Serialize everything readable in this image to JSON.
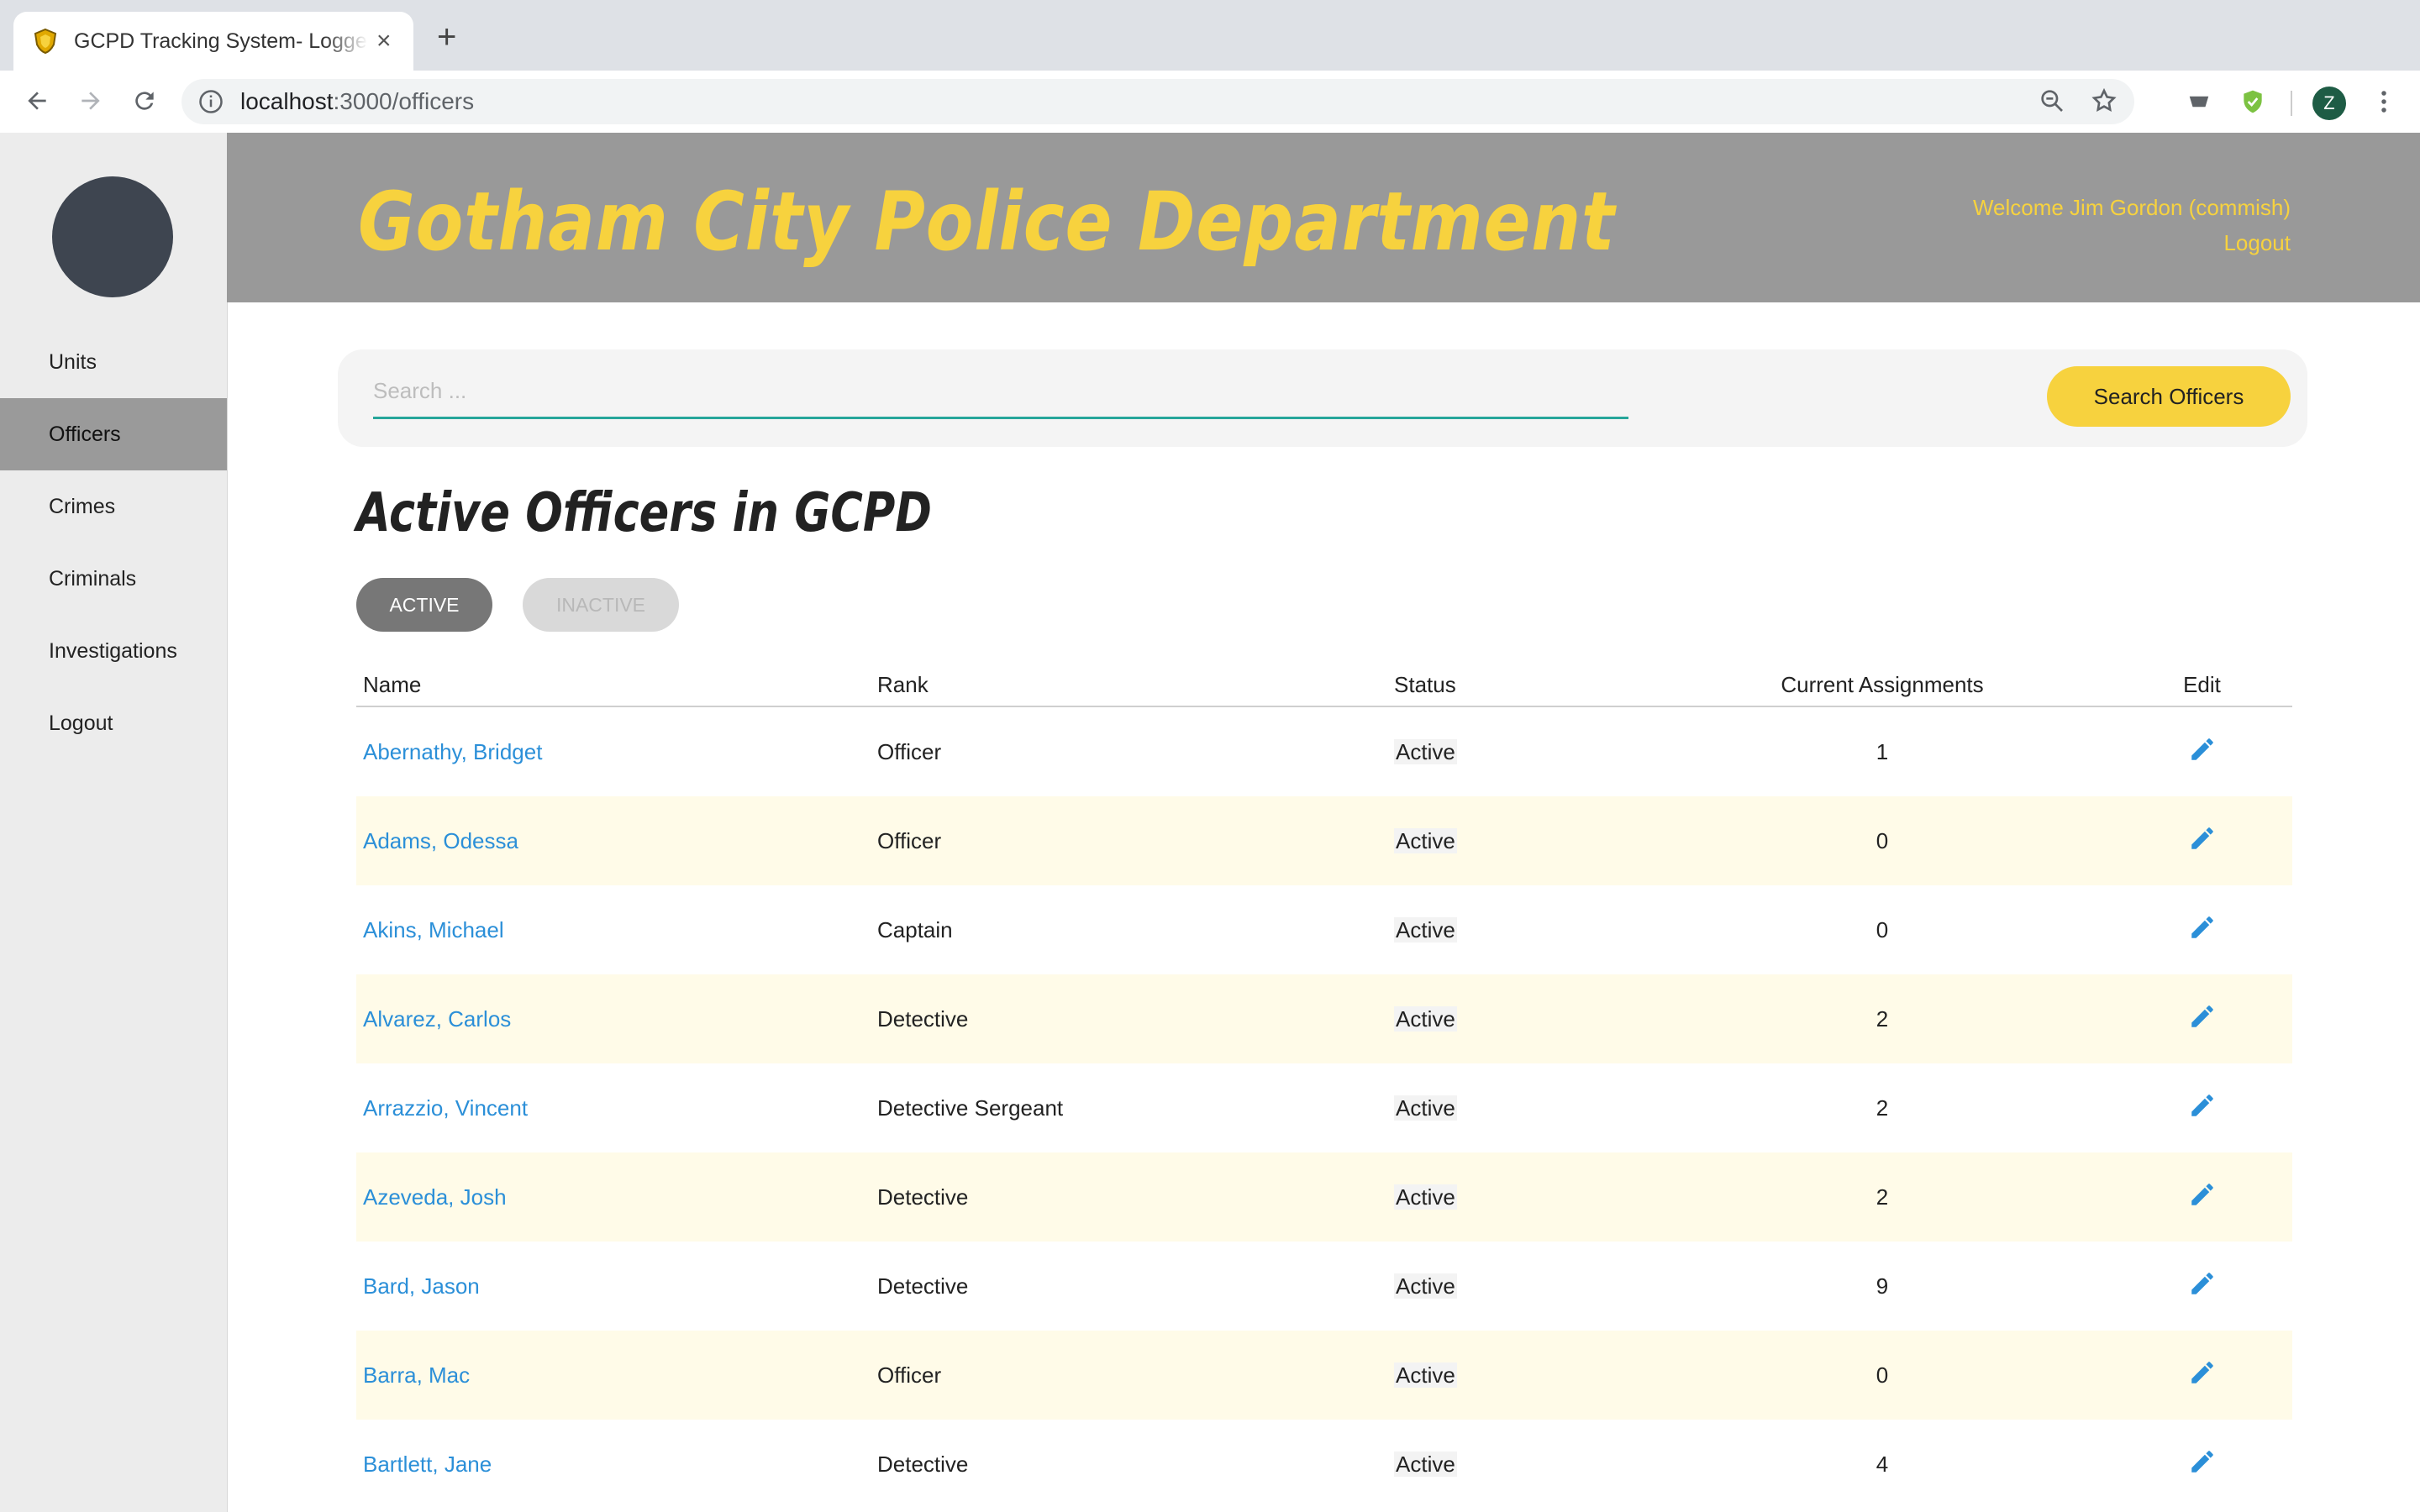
{
  "browser": {
    "tab_title": "GCPD Tracking System- Logged",
    "url_host": "localhost",
    "url_path": ":3000/officers",
    "profile_initial": "Z"
  },
  "sidebar": {
    "items": [
      {
        "label": "Units"
      },
      {
        "label": "Officers"
      },
      {
        "label": "Crimes"
      },
      {
        "label": "Criminals"
      },
      {
        "label": "Investigations"
      },
      {
        "label": "Logout"
      }
    ],
    "active_index": 1
  },
  "header": {
    "brand": "Gotham City Police Department",
    "welcome": "Welcome Jim Gordon (commish)",
    "logout": "Logout"
  },
  "search": {
    "placeholder": "Search ...",
    "value": "",
    "button_label": "Search Officers"
  },
  "page": {
    "title": "Active Officers in GCPD",
    "toggle_active": "ACTIVE",
    "toggle_inactive": "INACTIVE"
  },
  "table": {
    "columns": [
      "Name",
      "Rank",
      "Status",
      "Current Assignments",
      "Edit"
    ],
    "rows": [
      {
        "name": "Abernathy, Bridget",
        "rank": "Officer",
        "status": "Active",
        "assignments": "1"
      },
      {
        "name": "Adams, Odessa",
        "rank": "Officer",
        "status": "Active",
        "assignments": "0"
      },
      {
        "name": "Akins, Michael",
        "rank": "Captain",
        "status": "Active",
        "assignments": "0"
      },
      {
        "name": "Alvarez, Carlos",
        "rank": "Detective",
        "status": "Active",
        "assignments": "2"
      },
      {
        "name": "Arrazzio, Vincent",
        "rank": "Detective Sergeant",
        "status": "Active",
        "assignments": "2"
      },
      {
        "name": "Azeveda, Josh",
        "rank": "Detective",
        "status": "Active",
        "assignments": "2"
      },
      {
        "name": "Bard, Jason",
        "rank": "Detective",
        "status": "Active",
        "assignments": "9"
      },
      {
        "name": "Barra, Mac",
        "rank": "Officer",
        "status": "Active",
        "assignments": "0"
      },
      {
        "name": "Bartlett, Jane",
        "rank": "Detective",
        "status": "Active",
        "assignments": "4"
      }
    ]
  },
  "colors": {
    "brand_yellow": "#f7d23e",
    "header_gray": "#999999",
    "link_blue": "#2b8fd8",
    "accent_teal": "#26a69a"
  }
}
